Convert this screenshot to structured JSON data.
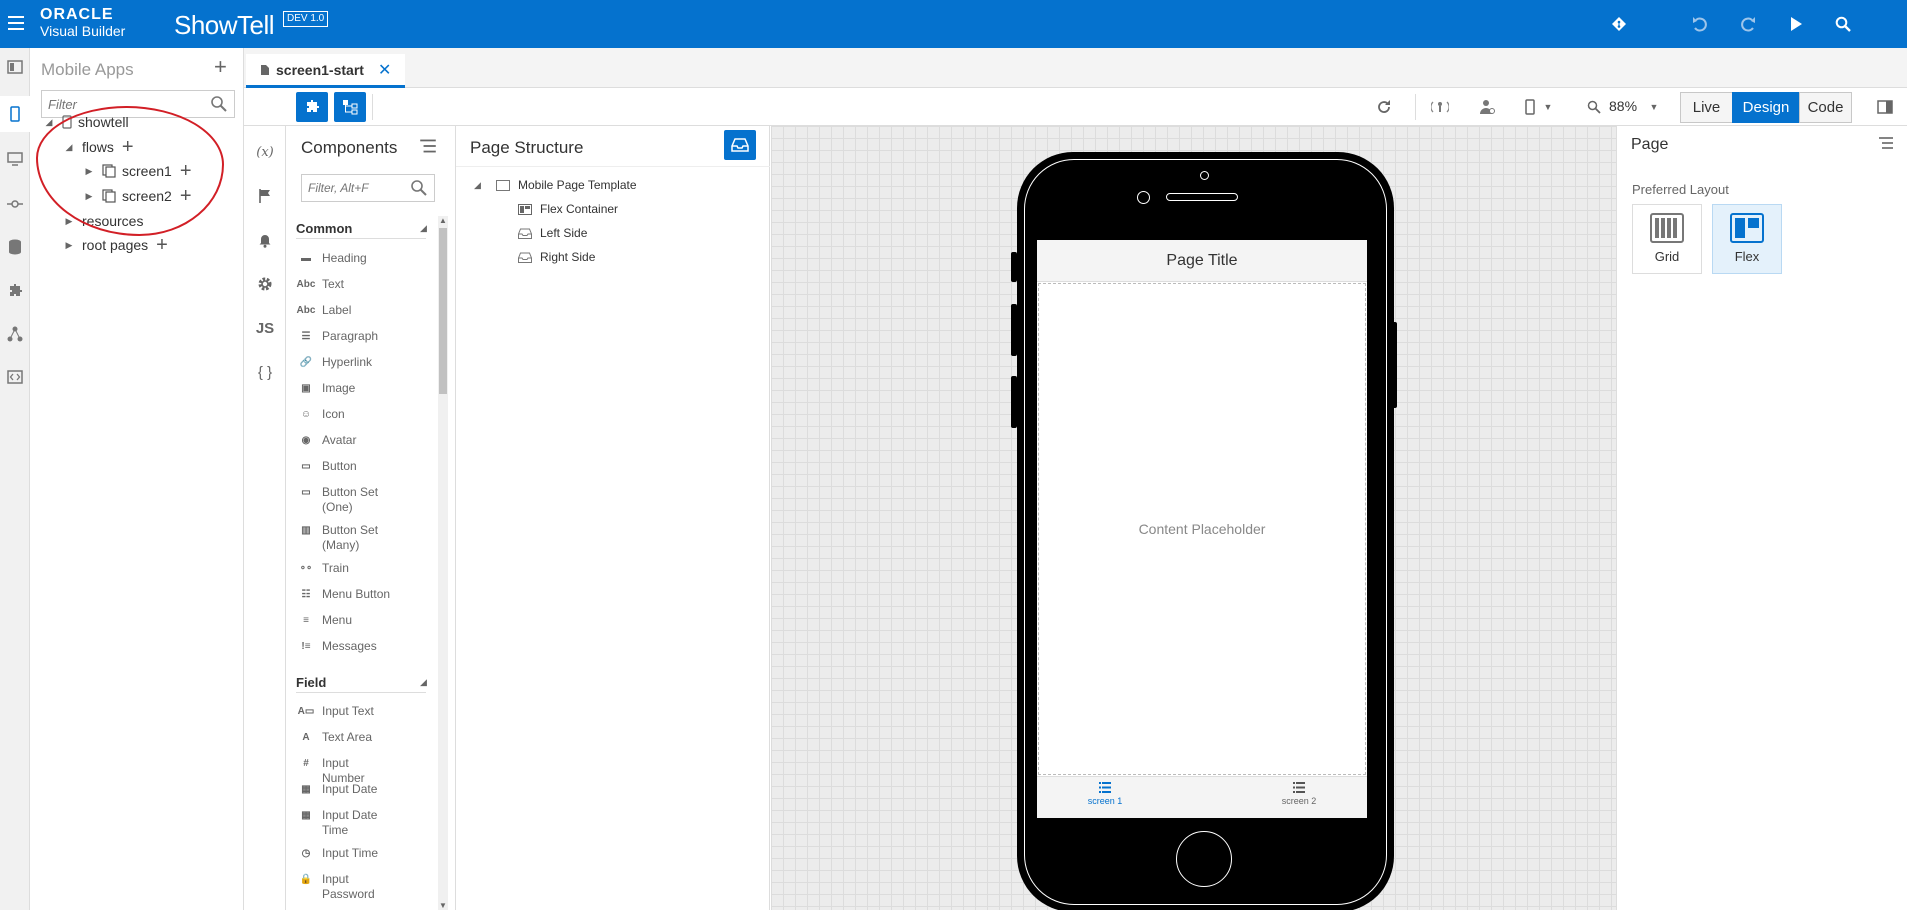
{
  "header": {
    "brand_line1": "ORACLE",
    "brand_line2": "Visual Builder",
    "app_name": "ShowTell",
    "badge": "DEV 1.0",
    "accent_color": "#0572ce",
    "icons": [
      "git-icon",
      "undo-icon",
      "redo-icon",
      "run-icon",
      "search-icon"
    ]
  },
  "left_strip": {
    "icons": [
      "web-apps-icon",
      "mobile-apps-icon",
      "desktop-icon",
      "service-connections-icon",
      "business-objects-icon",
      "components-icon",
      "processes-icon",
      "source-icon"
    ]
  },
  "navigator": {
    "title": "Mobile Apps",
    "filter_placeholder": "Filter",
    "tree": {
      "app": "showtell",
      "flows": "flows",
      "screen1": "screen1",
      "screen2": "screen2",
      "resources": "resources",
      "root_pages": "root pages"
    }
  },
  "tabs": {
    "active": "screen1-start"
  },
  "toolbar": {
    "zoom": "88%",
    "modes": {
      "live": "Live",
      "design": "Design",
      "code": "Code"
    },
    "active_mode": "Design"
  },
  "side_column": {
    "variables_label": "(x)",
    "js_label": "JS",
    "json_label": "{ }"
  },
  "palette": {
    "title": "Components",
    "filter_placeholder": "Filter, Alt+F",
    "sections": {
      "common": "Common",
      "field": "Field"
    },
    "common_items": [
      "Heading",
      "Text",
      "Label",
      "Paragraph",
      "Hyperlink",
      "Image",
      "Icon",
      "Avatar",
      "Button",
      "Button Set (One)",
      "Button Set (Many)",
      "Train",
      "Menu Button",
      "Menu",
      "Messages"
    ],
    "field_items": [
      "Input Text",
      "Text Area",
      "Input Number",
      "Input Date",
      "Input Date Time",
      "Input Time",
      "Input Password"
    ]
  },
  "structure": {
    "title": "Page Structure",
    "root": "Mobile Page Template",
    "children": [
      "Flex Container",
      "Left Side",
      "Right Side"
    ]
  },
  "canvas": {
    "page_title": "Page Title",
    "placeholder": "Content Placeholder",
    "nav_items": [
      "screen 1",
      "screen 2"
    ]
  },
  "properties": {
    "title": "Page",
    "preferred_layout_label": "Preferred Layout",
    "options": [
      "Grid",
      "Flex"
    ],
    "selected": "Flex"
  }
}
